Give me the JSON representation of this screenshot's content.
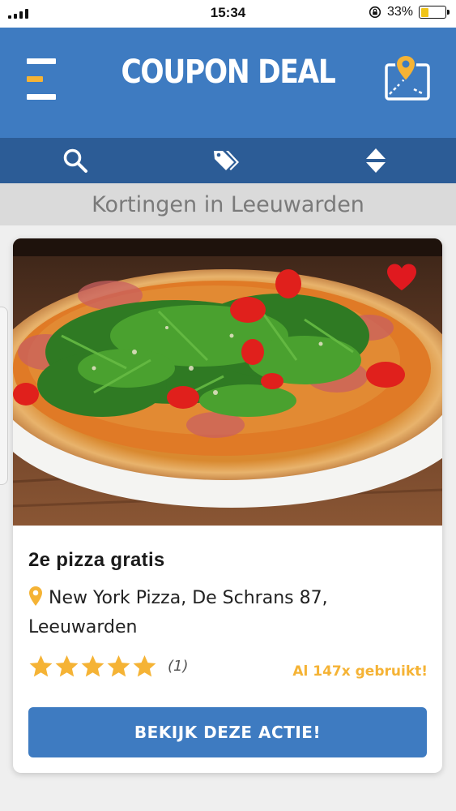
{
  "status_bar": {
    "time": "15:34",
    "battery_percent_label": "33%",
    "battery_level": 0.33
  },
  "header": {
    "title": "COUPON DEAL",
    "menu_icon": "hamburger-menu-icon",
    "map_icon": "map-pin-icon"
  },
  "toolbar": {
    "items": [
      {
        "icon": "search-icon"
      },
      {
        "icon": "tags-icon"
      },
      {
        "icon": "sort-icon"
      }
    ]
  },
  "location": {
    "title": "Kortingen in Leeuwarden"
  },
  "deal": {
    "title": "2e pizza gratis",
    "address": "New York Pizza, De Schrans 87, Leeuwarden",
    "rating": 5,
    "rating_max": 5,
    "review_count": "(1)",
    "used_count": "Al 147x gebruikt!",
    "cta_label": "BEKIJK DEZE ACTIE!",
    "favorite": true
  },
  "colors": {
    "brand_blue": "#3e7bc1",
    "toolbar_blue": "#2c5c96",
    "accent_orange": "#f5b335",
    "favorite_red": "#e0191f"
  }
}
